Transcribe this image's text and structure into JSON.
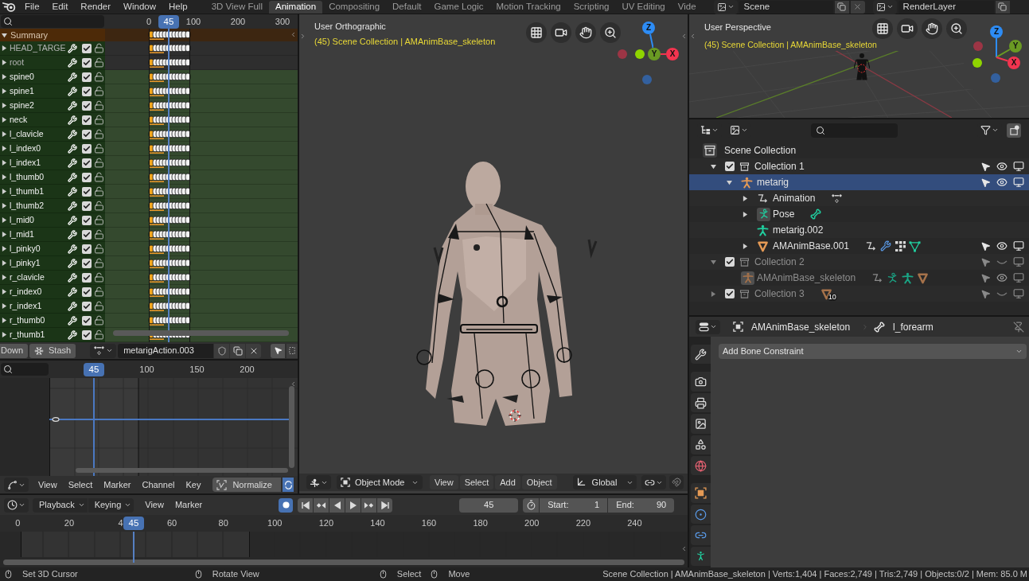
{
  "menu": [
    "File",
    "Edit",
    "Render",
    "Window",
    "Help"
  ],
  "workspaces": [
    {
      "label": "3D View Full",
      "selected": false
    },
    {
      "label": "Animation",
      "selected": true
    },
    {
      "label": "Compositing",
      "selected": false
    },
    {
      "label": "Default",
      "selected": false
    },
    {
      "label": "Game Logic",
      "selected": false
    },
    {
      "label": "Motion Tracking",
      "selected": false
    },
    {
      "label": "Scripting",
      "selected": false
    },
    {
      "label": "UV Editing",
      "selected": false
    },
    {
      "label": "Vide",
      "selected": false
    }
  ],
  "scene": {
    "value": "Scene"
  },
  "view_layer": {
    "value": "RenderLayer"
  },
  "dope_sheet": {
    "ruler": {
      "current_frame": "45",
      "ticks": [
        "0",
        "100",
        "200",
        "300"
      ]
    },
    "summary": {
      "label": "Summary",
      "expanded": true
    },
    "channels": [
      {
        "name": "HEAD_TARGE",
        "selected": false,
        "expanded": false,
        "enabled": true,
        "locked": false
      },
      {
        "name": "root",
        "selected": false,
        "expanded": false,
        "enabled": true,
        "locked": false
      },
      {
        "name": "spine0",
        "selected": true,
        "expanded": false,
        "enabled": true,
        "locked": false
      },
      {
        "name": "spine1",
        "selected": true,
        "expanded": false,
        "enabled": true,
        "locked": false
      },
      {
        "name": "spine2",
        "selected": true,
        "expanded": false,
        "enabled": true,
        "locked": false
      },
      {
        "name": "neck",
        "selected": true,
        "expanded": false,
        "enabled": true,
        "locked": false
      },
      {
        "name": "l_clavicle",
        "selected": true,
        "expanded": false,
        "enabled": true,
        "locked": false
      },
      {
        "name": "l_index0",
        "selected": true,
        "expanded": false,
        "enabled": true,
        "locked": false
      },
      {
        "name": "l_index1",
        "selected": true,
        "expanded": false,
        "enabled": true,
        "locked": false
      },
      {
        "name": "l_thumb0",
        "selected": true,
        "expanded": false,
        "enabled": true,
        "locked": false
      },
      {
        "name": "l_thumb1",
        "selected": true,
        "expanded": false,
        "enabled": true,
        "locked": false
      },
      {
        "name": "l_thumb2",
        "selected": true,
        "expanded": false,
        "enabled": true,
        "locked": false
      },
      {
        "name": "l_mid0",
        "selected": true,
        "expanded": false,
        "enabled": true,
        "locked": false
      },
      {
        "name": "l_mid1",
        "selected": true,
        "expanded": false,
        "enabled": true,
        "locked": false
      },
      {
        "name": "l_pinky0",
        "selected": true,
        "expanded": false,
        "enabled": true,
        "locked": false
      },
      {
        "name": "l_pinky1",
        "selected": true,
        "expanded": false,
        "enabled": true,
        "locked": false
      },
      {
        "name": "r_clavicle",
        "selected": true,
        "expanded": false,
        "enabled": true,
        "locked": false
      },
      {
        "name": "r_index0",
        "selected": true,
        "expanded": false,
        "enabled": true,
        "locked": false
      },
      {
        "name": "r_index1",
        "selected": true,
        "expanded": false,
        "enabled": true,
        "locked": false
      },
      {
        "name": "r_thumb0",
        "selected": true,
        "expanded": false,
        "enabled": true,
        "locked": false
      },
      {
        "name": "r_thumb1",
        "selected": true,
        "expanded": false,
        "enabled": true,
        "locked": false
      }
    ],
    "footer": {
      "buttons": [
        {
          "label": "Down",
          "kind": "plain"
        },
        {
          "label": "Stash",
          "kind": "stash"
        }
      ],
      "action": "metarigAction.003"
    }
  },
  "graph_editor": {
    "ruler": {
      "current_frame": "45",
      "ticks": [
        "100",
        "150",
        "200"
      ]
    },
    "menu": [
      "View",
      "Select",
      "Marker",
      "Channel",
      "Key"
    ],
    "normalize": {
      "label": "Normalize",
      "on": false
    },
    "auto_normalize": {
      "on": true
    }
  },
  "viewport": {
    "title": "User Orthographic",
    "info": "(45) Scene Collection | AMAnimBase_skeleton",
    "axes": [
      {
        "label": "Z",
        "color": "#2d8cf5"
      },
      {
        "label": "Y",
        "color": "#6a9a23"
      },
      {
        "label": "X",
        "color": "#f2344f"
      }
    ],
    "mode": "Object Mode",
    "menu": [
      "View",
      "Select",
      "Add",
      "Object"
    ],
    "orientation": "Global"
  },
  "perspective_view": {
    "title": "User Perspective",
    "info": "(45) Scene Collection | AMAnimBase_skeleton",
    "axes": [
      {
        "label": "Z",
        "color": "#2d8cf5"
      },
      {
        "label": "Y",
        "color": "#6a9a23"
      },
      {
        "label": "X",
        "color": "#f2344f"
      }
    ]
  },
  "outliner": {
    "tree": [
      {
        "label": "Scene Collection",
        "kind": "scene",
        "selected": false,
        "children": [
          {
            "label": "Collection 1",
            "kind": "collection",
            "selected": false,
            "expanded": true,
            "checked": true,
            "visible": true,
            "dimmed": false,
            "children": [
              {
                "label": "metarig",
                "kind": "armature",
                "selected": true,
                "expanded": true,
                "visible": true,
                "dimmed": false,
                "children": [
                  {
                    "label": "Animation",
                    "kind": "animation",
                    "selected": false,
                    "expanded": false,
                    "extras": [
                      {
                        "kind": "action"
                      }
                    ]
                  },
                  {
                    "label": "Pose",
                    "kind": "pose",
                    "selected": false,
                    "expanded": false,
                    "extras": [
                      {
                        "kind": "bone"
                      }
                    ]
                  },
                  {
                    "label": "metarig.002",
                    "kind": "armature_data",
                    "selected": false
                  },
                  {
                    "label": "AMAnimBase.001",
                    "kind": "mesh",
                    "selected": false,
                    "expanded": false,
                    "visible": true,
                    "dimmed": false,
                    "extras": [
                      {
                        "kind": "animation"
                      },
                      {
                        "kind": "modifier"
                      },
                      {
                        "kind": "vertex_groups"
                      },
                      {
                        "kind": "mesh_data"
                      }
                    ]
                  }
                ]
              }
            ]
          },
          {
            "label": "Collection 2",
            "kind": "collection",
            "selected": false,
            "expanded": true,
            "checked": true,
            "visible": false,
            "dimmed": true,
            "children": [
              {
                "label": "AMAnimBase_skeleton",
                "kind": "armature_boxed",
                "selected": false,
                "visible": true,
                "dimmed": true,
                "extras": [
                  {
                    "kind": "animation"
                  },
                  {
                    "kind": "pose"
                  },
                  {
                    "kind": "armature_data"
                  },
                  {
                    "kind": "mesh"
                  }
                ]
              }
            ]
          },
          {
            "label": "Collection 3",
            "kind": "collection",
            "selected": false,
            "expanded": false,
            "checked": true,
            "visible": false,
            "dimmed": true,
            "extras": [
              {
                "kind": "mesh",
                "count": "10"
              }
            ]
          }
        ]
      }
    ]
  },
  "properties": {
    "object": "AMAnimBase_skeleton",
    "bone": "l_forearm",
    "pinned": false,
    "add_menu": "Add Bone Constraint"
  },
  "timeline": {
    "menu": [
      {
        "label": "Playback",
        "kind": "dropdown"
      },
      {
        "label": "Keying",
        "kind": "dropdown"
      },
      {
        "label": "View",
        "kind": "menu"
      },
      {
        "label": "Marker",
        "kind": "menu"
      }
    ],
    "auto_keying": {
      "on": true
    },
    "current_frame": "45",
    "start": {
      "label": "Start:",
      "value": "1"
    },
    "end": {
      "label": "End:",
      "value": "90"
    },
    "ruler": {
      "current_frame": "45",
      "ticks": [
        "0",
        "20",
        "4",
        "60",
        "80",
        "100",
        "120",
        "140",
        "160",
        "180",
        "200",
        "220",
        "240"
      ]
    }
  },
  "status_bar": {
    "hints": [
      "Set 3D Cursor",
      "Rotate View",
      "Select",
      "Move"
    ],
    "stats": "Scene Collection | AMAnimBase_skeleton | Verts:1,404 | Faces:2,749 | Tris:2,749 | Objects:0/2 | Mem: 85.0 M"
  }
}
